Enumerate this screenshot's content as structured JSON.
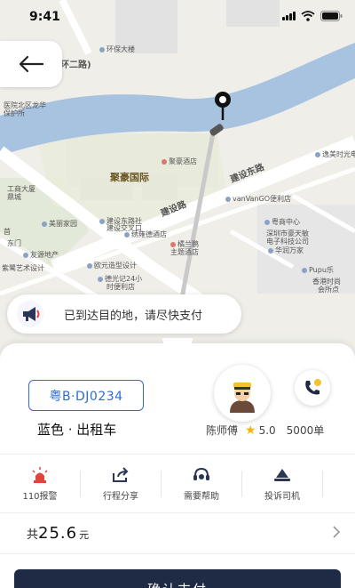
{
  "status_bar": {
    "time": "9:41"
  },
  "map": {
    "labels": {
      "environment_building": "环保大楼",
      "ring_road": "环二路)",
      "district_left1": "医院北区龙华",
      "district_left2": "保护所",
      "juhao": "聚豪国际",
      "juhao_hotel": "聚豪酒店",
      "jianshe_east": "建设东路",
      "jianshe_road": "建设路",
      "vanvango": "vanVanGO便利店",
      "gonghui": "工商大厦",
      "gonghui2": "鼎城",
      "meili": "美丽家园",
      "shou": "首",
      "jianshe_bus": "建设东路社",
      "jianshe_bus2": "建设交叉口",
      "xiuwei": "绣雍德酒店",
      "jialan": "橘兰鹏",
      "jialan2": "主题酒店",
      "east_gate": "东门",
      "friend": "友源地产",
      "art_school": "紫鹭艺术设计",
      "ou_brand": "欧元造型设计",
      "ann": "德光记24小",
      "ann2": "时便利店",
      "food": "粤商中心",
      "fudong": "深圳市豪天敏",
      "fudong2": "电子科技公司",
      "huaruhuasheng": "华润万家",
      "pupu": "Pupu乐",
      "maxwell": "香港时尚",
      "maxwell2": "会所点",
      "yijia": "逸美时光电"
    }
  },
  "toast": {
    "message": "已到达目的地，请尽快支付"
  },
  "vehicle": {
    "plate": "粤B·DJ0234",
    "description": "蓝色 · 出租车"
  },
  "driver": {
    "name": "陈师傅",
    "rating": "5.0",
    "orders": "5000单"
  },
  "actions": [
    {
      "label": "110报警",
      "icon": "alarm-icon"
    },
    {
      "label": "行程分享",
      "icon": "share-icon"
    },
    {
      "label": "需要帮助",
      "icon": "headset-icon"
    },
    {
      "label": "投诉司机",
      "icon": "complaint-icon"
    }
  ],
  "fare": {
    "prefix": "共",
    "amount": "25.6",
    "unit": "元"
  },
  "pay_button": {
    "label": "确认支付"
  },
  "colors": {
    "accent": "#2e6ccf",
    "river": "#a8c3e0",
    "button": "#1f2a44",
    "star": "#f2b705"
  }
}
